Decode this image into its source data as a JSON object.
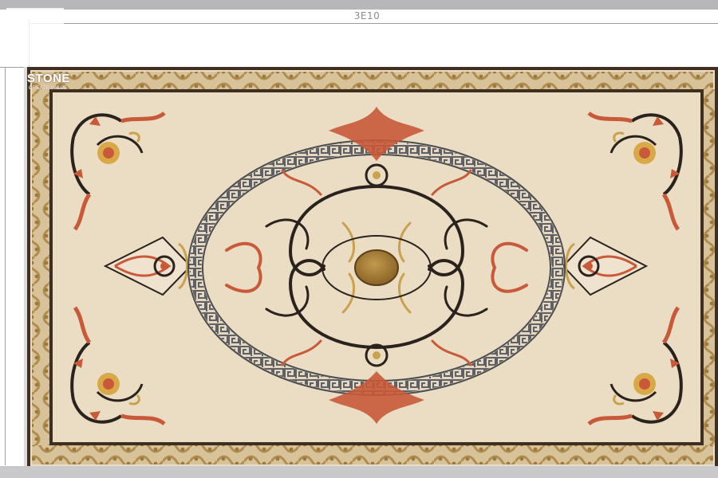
{
  "dimension": {
    "width_label": "3E10"
  },
  "watermark": {
    "brand": "STONE",
    "tagline": "CREATE VALUE"
  },
  "colors": {
    "background": "#ebdcc4",
    "border_band": "#3f2f22",
    "border_vine": "#b08d4f",
    "scroll_dark": "#2a221d",
    "accent_red": "#c85a3a",
    "accent_gold": "#c9a24e",
    "key_band": "#6b6d70",
    "center": "#a77b32"
  },
  "icons": {
    "corner": "floral-corner-icon",
    "center": "medallion-center-icon"
  }
}
